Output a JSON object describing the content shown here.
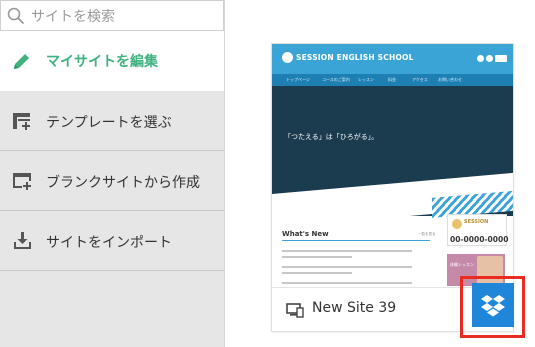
{
  "search": {
    "placeholder": "サイトを検索"
  },
  "sidebar": {
    "my_site_label": "マイサイトを編集",
    "items": [
      {
        "label": "テンプレートを選ぶ",
        "icon": "template-add-icon"
      },
      {
        "label": "ブランクサイトから作成",
        "icon": "blank-site-add-icon"
      },
      {
        "label": "サイトをインポート",
        "icon": "import-icon"
      }
    ]
  },
  "colors": {
    "accent_green": "#3fb27f",
    "dropbox_blue": "#1f86d9",
    "highlight_red": "#ea2b20"
  },
  "site_card": {
    "name": "New Site 39",
    "thumbnail": {
      "logo_text": "SESSION ENGLISH SCHOOL",
      "nav": [
        "トップページ",
        "コースのご案内",
        "レッスン",
        "料金",
        "アクセス",
        "お問い合わせ"
      ],
      "hero_text": "「つたえる」は「ひろがる」。",
      "whats_new": "What's New",
      "more_link": "一覧を見る",
      "side_logo": "SESSION",
      "phone": "00-0000-0000",
      "side_caption": "体験レッスン"
    }
  }
}
